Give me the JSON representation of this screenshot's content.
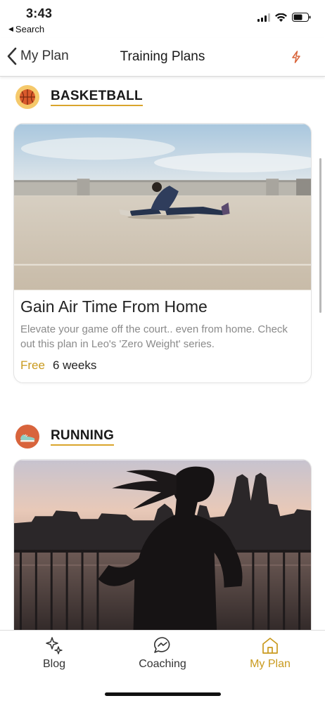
{
  "status_bar": {
    "time": "3:43",
    "back_app_label": "Search",
    "icons": [
      "cellular-signal-icon",
      "wifi-icon",
      "battery-icon"
    ]
  },
  "nav": {
    "back_label": "My Plan",
    "title": "Training Plans",
    "action_icon": "lightning-bolt-icon"
  },
  "sections": [
    {
      "title": "BASKETBALL",
      "icon": "basketball-icon",
      "icon_bg": "#f5c96b",
      "card": {
        "title": "Gain Air Time From Home",
        "description": "Elevate your game off the court.. even from home. Check out this plan in Leo's 'Zero Weight' series.",
        "price": "Free",
        "duration": "6 weeks",
        "image": "photo of a man stretching on a rooftop parking lot"
      }
    },
    {
      "title": "RUNNING",
      "icon": "running-shoe-icon",
      "icon_bg": "#d8643c",
      "card": {
        "image": "silhouette of a woman running by a city skyline at dusk"
      }
    }
  ],
  "tabs": [
    {
      "label": "Blog",
      "icon": "sparkle-icon",
      "active": false
    },
    {
      "label": "Coaching",
      "icon": "chat-bubble-icon",
      "active": false
    },
    {
      "label": "My Plan",
      "icon": "home-icon",
      "active": true
    }
  ],
  "colors": {
    "accent": "#c99a1e",
    "underline": "#d9a52c",
    "text": "#1c1c1c",
    "muted": "#8a8a8a"
  }
}
